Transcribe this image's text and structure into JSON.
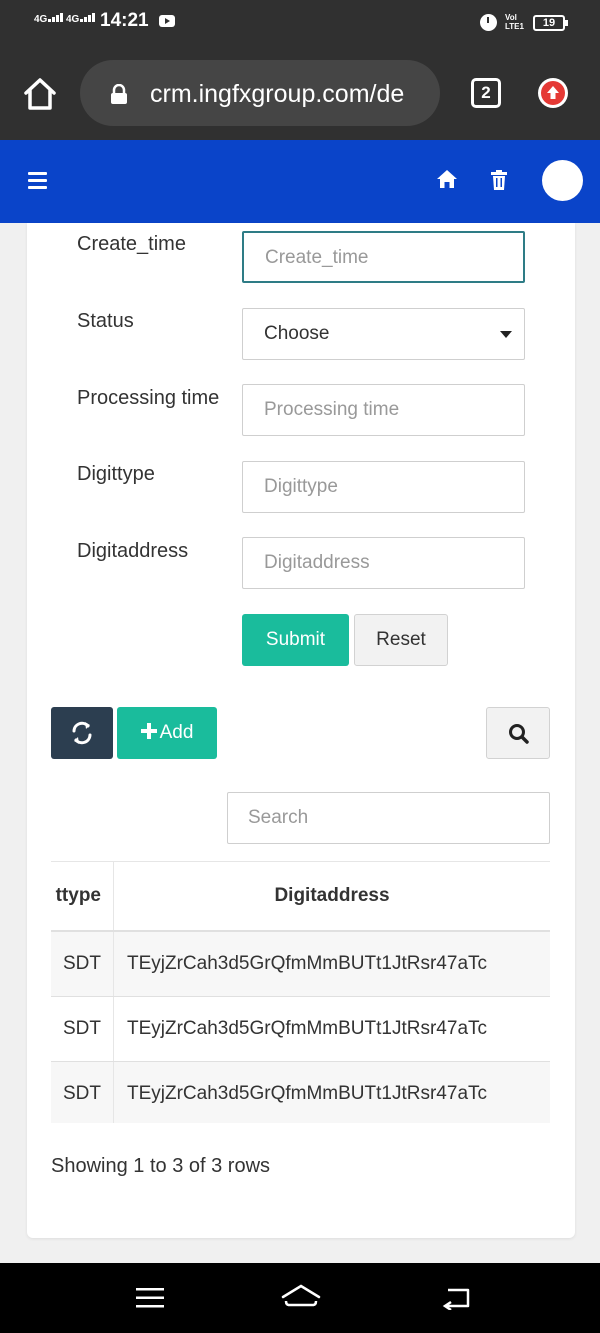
{
  "status_bar": {
    "network1": "4G",
    "network2": "4G",
    "time": "14:21",
    "volte": "Vol\nLTE1",
    "battery": "19"
  },
  "browser": {
    "url": "crm.ingfxgroup.com/de",
    "tab_count": "2"
  },
  "form": {
    "fields": [
      {
        "label": "Create_time",
        "placeholder": "Create_time"
      },
      {
        "label": "Status",
        "value": "Choose"
      },
      {
        "label": "Processing time",
        "placeholder": "Processing time"
      },
      {
        "label": "Digittype",
        "placeholder": "Digittype"
      },
      {
        "label": "Digitaddress",
        "placeholder": "Digitaddress"
      }
    ],
    "submit_label": "Submit",
    "reset_label": "Reset"
  },
  "toolbar": {
    "add_label": "Add",
    "search_placeholder": "Search"
  },
  "table": {
    "columns": [
      "Digittype",
      "Digitaddress"
    ],
    "visible_headers": [
      "ttype",
      "Digitaddress"
    ],
    "rows": [
      {
        "digittype_visible": "SDT",
        "digitaddress": "TEyjZrCah3d5GrQfmMmBUTt1JtRsr47aTc"
      },
      {
        "digittype_visible": "SDT",
        "digitaddress": "TEyjZrCah3d5GrQfmMmBUTt1JtRsr47aTc"
      },
      {
        "digittype_visible": "SDT",
        "digitaddress": "TEyjZrCah3d5GrQfmMmBUTt1JtRsr47aTc"
      }
    ],
    "summary": "Showing 1 to 3 of 3 rows"
  },
  "colors": {
    "header_blue": "#0a44c9",
    "accent_green": "#1abc9c",
    "refresh_dark": "#2c3e50"
  },
  "icons": [
    "home-icon",
    "lock-icon",
    "tabs-icon",
    "update-icon",
    "menu-icon",
    "trash-icon",
    "refresh-icon",
    "plus-icon",
    "search-icon"
  ]
}
